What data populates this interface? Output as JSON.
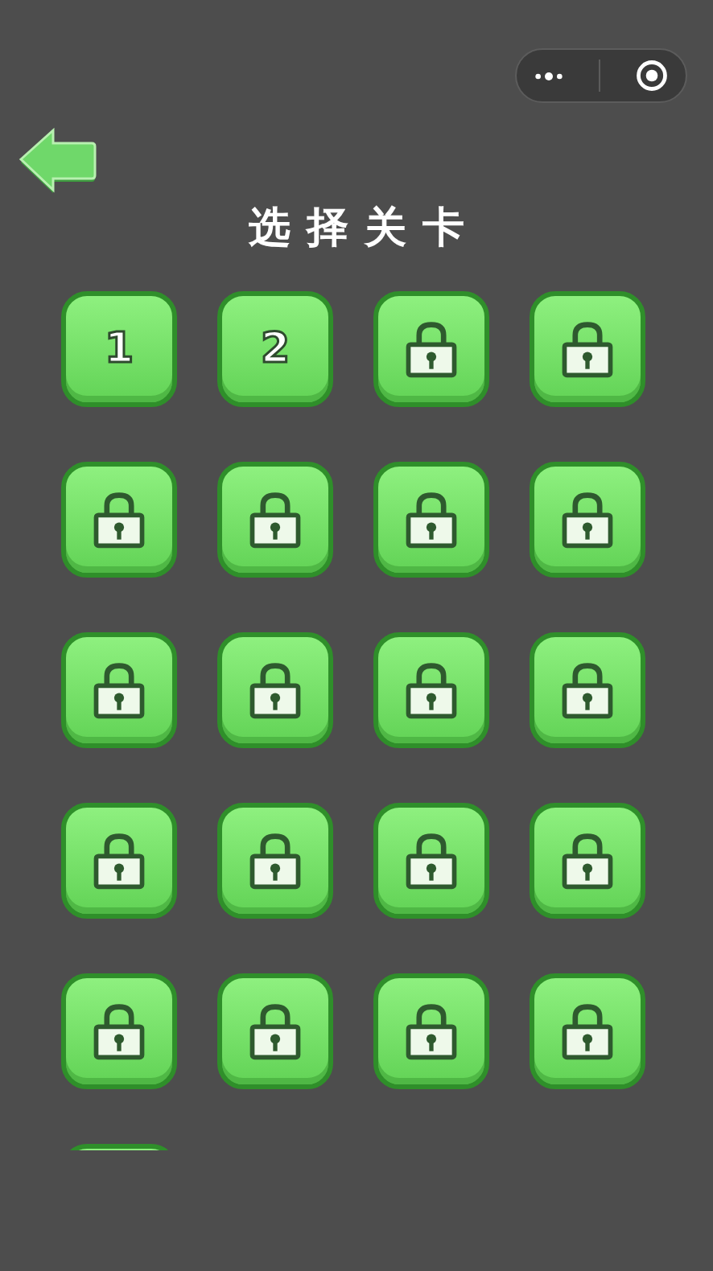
{
  "title": "选择关卡",
  "levels": [
    {
      "kind": "unlocked",
      "label": "1"
    },
    {
      "kind": "unlocked",
      "label": "2"
    },
    {
      "kind": "locked"
    },
    {
      "kind": "locked"
    },
    {
      "kind": "locked"
    },
    {
      "kind": "locked"
    },
    {
      "kind": "locked"
    },
    {
      "kind": "locked"
    },
    {
      "kind": "locked"
    },
    {
      "kind": "locked"
    },
    {
      "kind": "locked"
    },
    {
      "kind": "locked"
    },
    {
      "kind": "locked"
    },
    {
      "kind": "locked"
    },
    {
      "kind": "locked"
    },
    {
      "kind": "locked"
    },
    {
      "kind": "locked"
    },
    {
      "kind": "locked"
    },
    {
      "kind": "locked"
    },
    {
      "kind": "locked"
    },
    {
      "kind": "cut-off"
    }
  ]
}
